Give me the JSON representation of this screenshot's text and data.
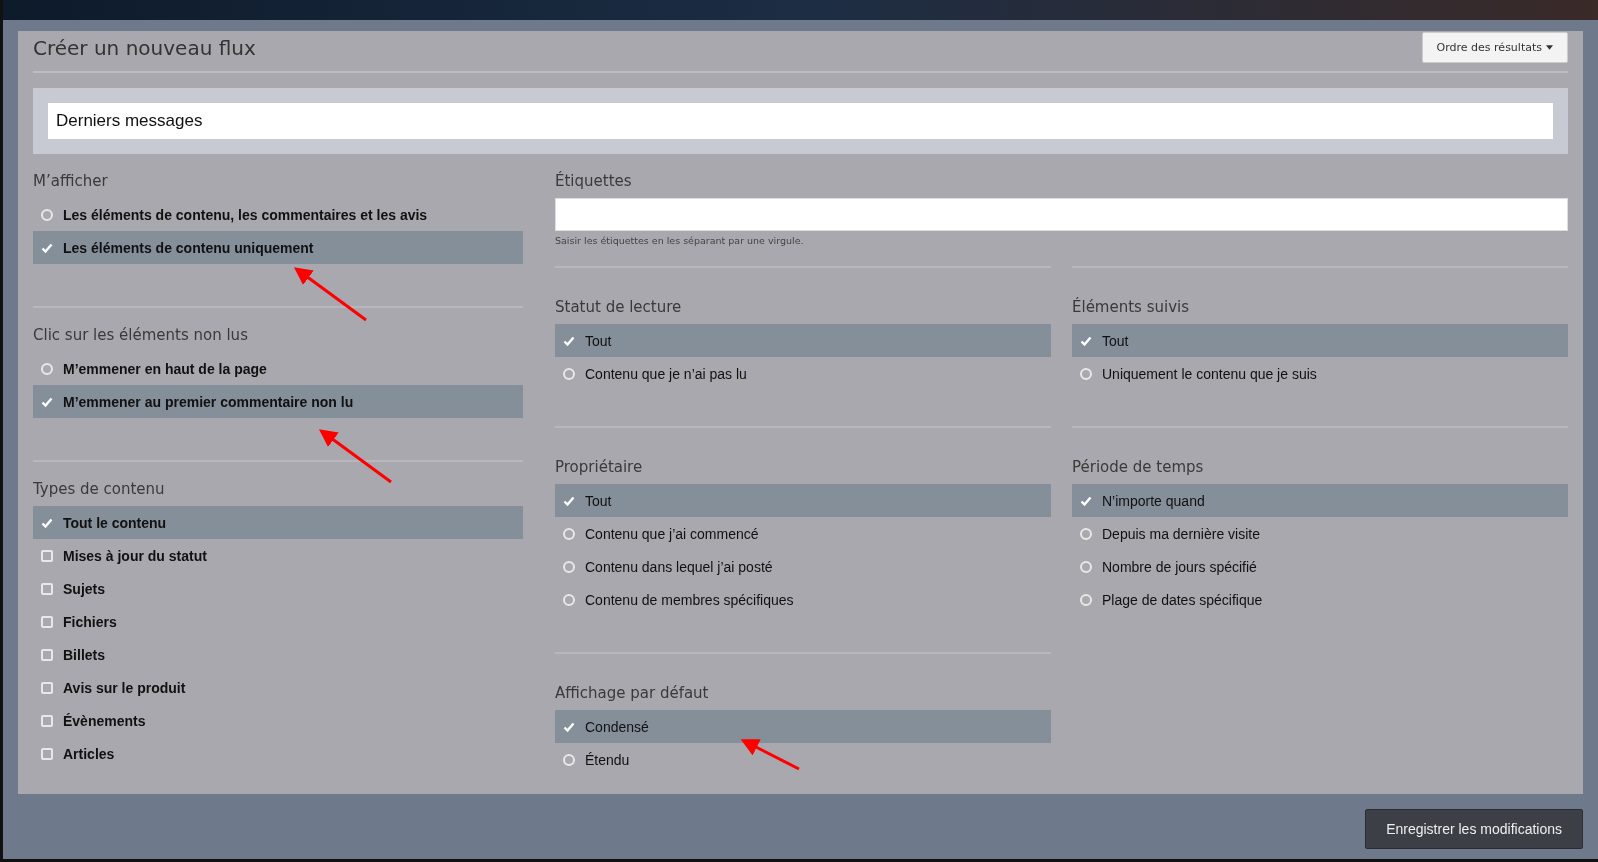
{
  "header": {
    "title": "Créer un nouveau flux",
    "sort_button": "Ordre des résultats"
  },
  "feed_name": {
    "value": "Derniers messages"
  },
  "left_sections": [
    {
      "title": "M’afficher",
      "kind": "radio",
      "options": [
        {
          "label": "Les éléments de contenu, les commentaires et les avis",
          "selected": false
        },
        {
          "label": "Les éléments de contenu uniquement",
          "selected": true
        }
      ]
    },
    {
      "title": "Clic sur les éléments non lus",
      "kind": "radio",
      "options": [
        {
          "label": "M’emmener en haut de la page",
          "selected": false
        },
        {
          "label": "M’emmener au premier commentaire non lu",
          "selected": true
        }
      ]
    },
    {
      "title": "Types de contenu",
      "kind": "checkbox",
      "options": [
        {
          "label": "Tout le contenu",
          "selected": true
        },
        {
          "label": "Mises à jour du statut",
          "selected": false
        },
        {
          "label": "Sujets",
          "selected": false
        },
        {
          "label": "Fichiers",
          "selected": false
        },
        {
          "label": "Billets",
          "selected": false
        },
        {
          "label": "Avis sur le produit",
          "selected": false
        },
        {
          "label": "Évènements",
          "selected": false
        },
        {
          "label": "Articles",
          "selected": false
        }
      ]
    }
  ],
  "tags": {
    "label": "Étiquettes",
    "hint": "Saisir les étiquettes en les séparant par une virgule."
  },
  "right_sections": [
    {
      "title": "Statut de lecture",
      "kind": "radio",
      "options": [
        {
          "label": "Tout",
          "selected": true
        },
        {
          "label": "Contenu que je n’ai pas lu",
          "selected": false
        }
      ]
    },
    {
      "title": "Éléments suivis",
      "kind": "radio",
      "options": [
        {
          "label": "Tout",
          "selected": true
        },
        {
          "label": "Uniquement le contenu que je suis",
          "selected": false
        }
      ]
    },
    {
      "title": "Propriétaire",
      "kind": "radio",
      "options": [
        {
          "label": "Tout",
          "selected": true
        },
        {
          "label": "Contenu que j’ai commencé",
          "selected": false
        },
        {
          "label": "Contenu dans lequel j’ai posté",
          "selected": false
        },
        {
          "label": "Contenu de membres spécifiques",
          "selected": false
        }
      ]
    },
    {
      "title": "Période de temps",
      "kind": "radio",
      "options": [
        {
          "label": "N’importe quand",
          "selected": true
        },
        {
          "label": "Depuis ma dernière visite",
          "selected": false
        },
        {
          "label": "Nombre de jours spécifié",
          "selected": false
        },
        {
          "label": "Plage de dates spécifique",
          "selected": false
        }
      ]
    },
    {
      "title": "Affichage par défaut",
      "kind": "radio",
      "options": [
        {
          "label": "Condensé",
          "selected": true
        },
        {
          "label": "Étendu",
          "selected": false
        }
      ]
    }
  ],
  "save_button": "Enregistrer les modifications"
}
